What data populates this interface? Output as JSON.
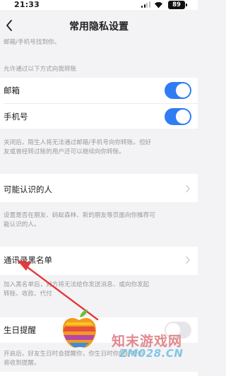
{
  "status_bar": {
    "time": "21:33",
    "battery": "89"
  },
  "nav": {
    "title": "常用隐私设置"
  },
  "top_hint": "邮箱/手机号找到你。",
  "transfer_section": {
    "header": "允许通过以下方式向我转账",
    "items": [
      {
        "label": "邮箱",
        "enabled": true
      },
      {
        "label": "手机号",
        "enabled": true
      }
    ],
    "footer_lines": [
      "关闭后，陌生人将无法通过邮箱/手机号向你转账。但好",
      "友或曾经转过账的用户还可以继续向你转账。"
    ]
  },
  "people_you_may_know": {
    "label": "可能认识的人",
    "hint_lines": [
      "设置是否在朋友、蚂蚁森林、新的朋友等页面向你推荐可",
      "能认识的人。"
    ]
  },
  "contacts_blacklist": {
    "label": "通讯录黑名单",
    "hint_lines": [
      "加入黑名单后，对方将无法给你发送消息、或向你发起",
      "转账、收款、代付"
    ]
  },
  "birthday_reminder": {
    "label": "生日提醒",
    "enabled": false,
    "hint_lines": [
      "开启后，好友生日时会提醒你，你生日时你的好友也",
      "将收到提醒。"
    ]
  },
  "watermark": {
    "text": "知末游戏网",
    "url": "ZM028.CN"
  },
  "colors": {
    "accent": "#2f7cf3",
    "background": "#f3f3f5",
    "annotation_arrow": "#e23b3b"
  }
}
